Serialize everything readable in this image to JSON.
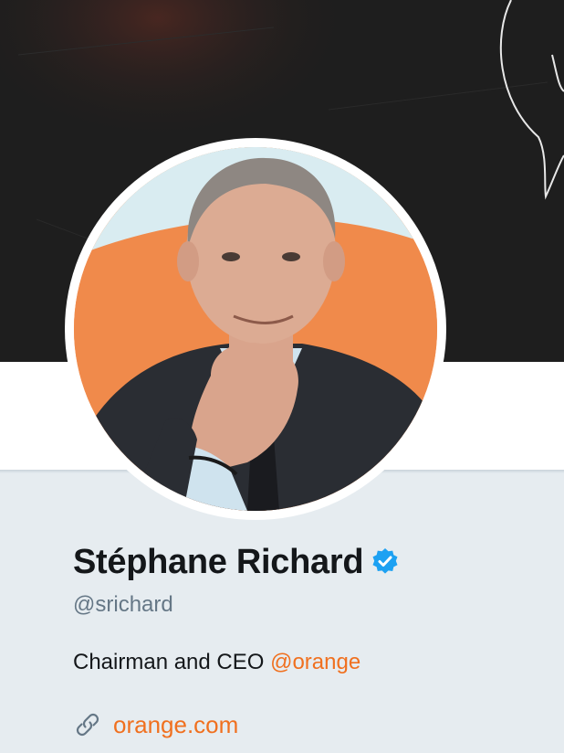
{
  "profile": {
    "name": "Stéphane Richard",
    "verified": true,
    "verified_icon": "verified-badge-icon",
    "handle": "@srichard",
    "bio_text": "Chairman and CEO ",
    "bio_mention": "@orange",
    "website_icon": "link-icon",
    "website": "orange.com"
  },
  "colors": {
    "page_background": "#e6ecf0",
    "header_background": "#1f1f1f",
    "name_color": "#14171a",
    "handle_color": "#657786",
    "link_color": "#f0701f",
    "verified_color": "#1da1f2",
    "avatar_background": "#f08a4b"
  }
}
